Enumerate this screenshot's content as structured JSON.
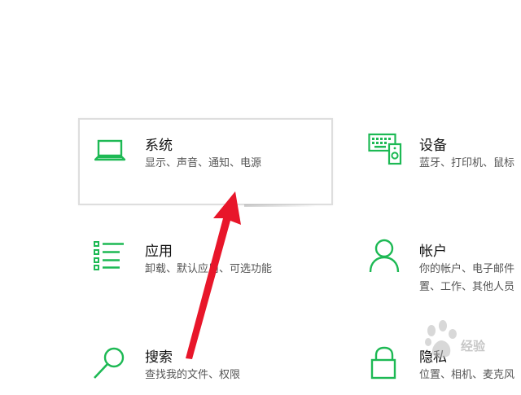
{
  "accent_color": "#1db954",
  "arrow_color": "#e8162a",
  "tiles": {
    "system": {
      "title": "系统",
      "desc": "显示、声音、通知、电源",
      "icon": "laptop-icon"
    },
    "devices": {
      "title": "设备",
      "desc": "蓝牙、打印机、鼠标",
      "icon": "keyboard-speaker-icon"
    },
    "apps": {
      "title": "应用",
      "desc": "卸载、默认应用、可选功能",
      "icon": "app-list-icon"
    },
    "accounts": {
      "title": "帐户",
      "desc_line1": "你的帐户、电子邮件",
      "desc_line2": "置、工作、其他人员",
      "icon": "person-icon"
    },
    "search": {
      "title": "搜索",
      "desc": "查找我的文件、权限",
      "icon": "search-icon"
    },
    "privacy": {
      "title": "隐私",
      "desc": "位置、相机、麦克风",
      "icon": "lock-icon"
    }
  },
  "watermark": {
    "text": "经验",
    "icon": "baidu-paw-icon"
  }
}
